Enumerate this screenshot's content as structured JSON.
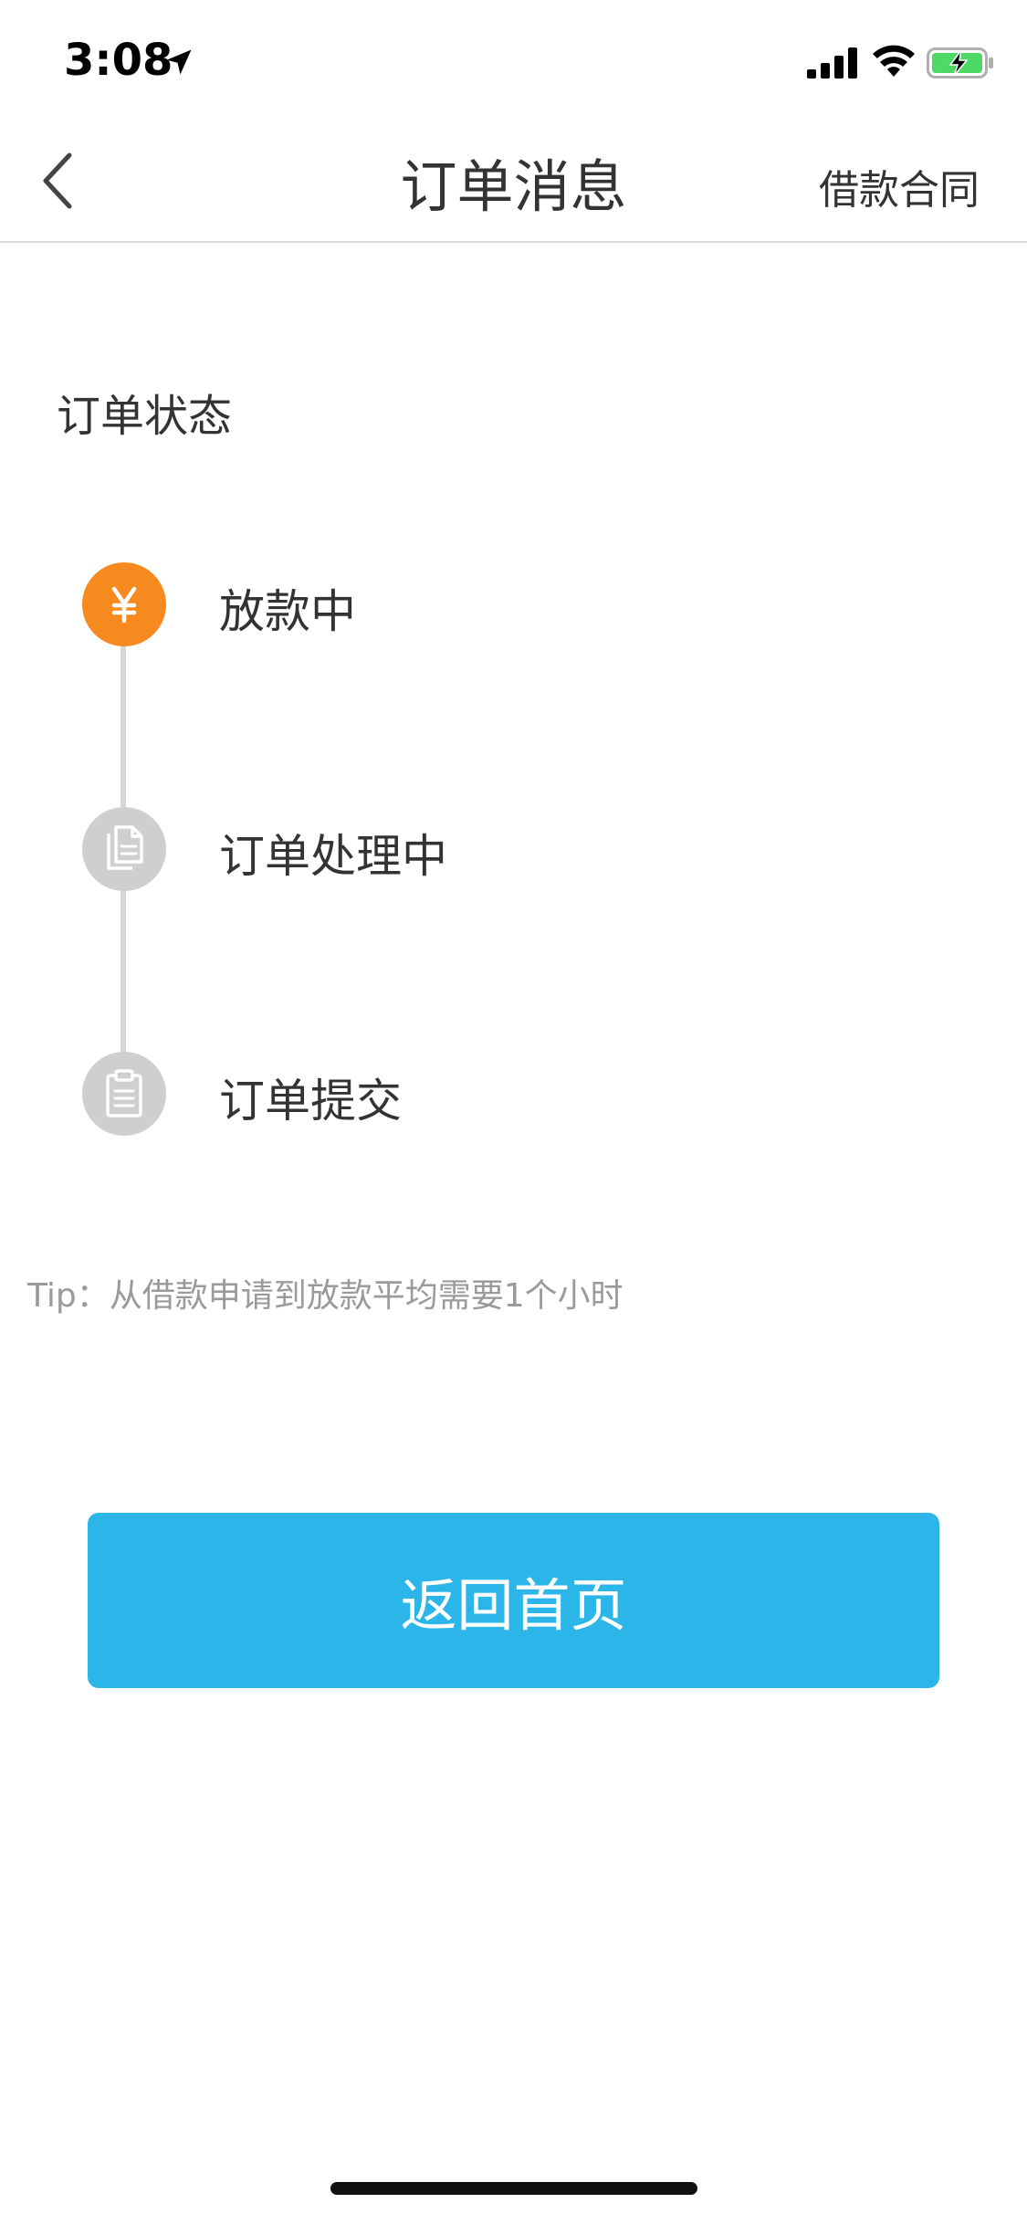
{
  "status_bar": {
    "time": "3:08",
    "icons": [
      "location-arrow-icon",
      "signal-icon",
      "wifi-icon",
      "battery-charging-icon"
    ],
    "battery_color": "#4cd964"
  },
  "nav": {
    "back_icon": "chevron-left-icon",
    "title": "订单消息",
    "right_action": "借款合同"
  },
  "order_status": {
    "section_title": "订单状态",
    "steps": [
      {
        "label": "放款中",
        "icon": "yen-icon",
        "state": "active",
        "color": "#f78a1e"
      },
      {
        "label": "订单处理中",
        "icon": "document-copy-icon",
        "state": "inactive",
        "color": "#cfcfcf"
      },
      {
        "label": "订单提交",
        "icon": "clipboard-icon",
        "state": "inactive",
        "color": "#cfcfcf"
      }
    ]
  },
  "tip": "Tip：从借款申请到放款平均需要1个小时",
  "home_button": {
    "label": "返回首页",
    "color": "#2bb5e8"
  }
}
